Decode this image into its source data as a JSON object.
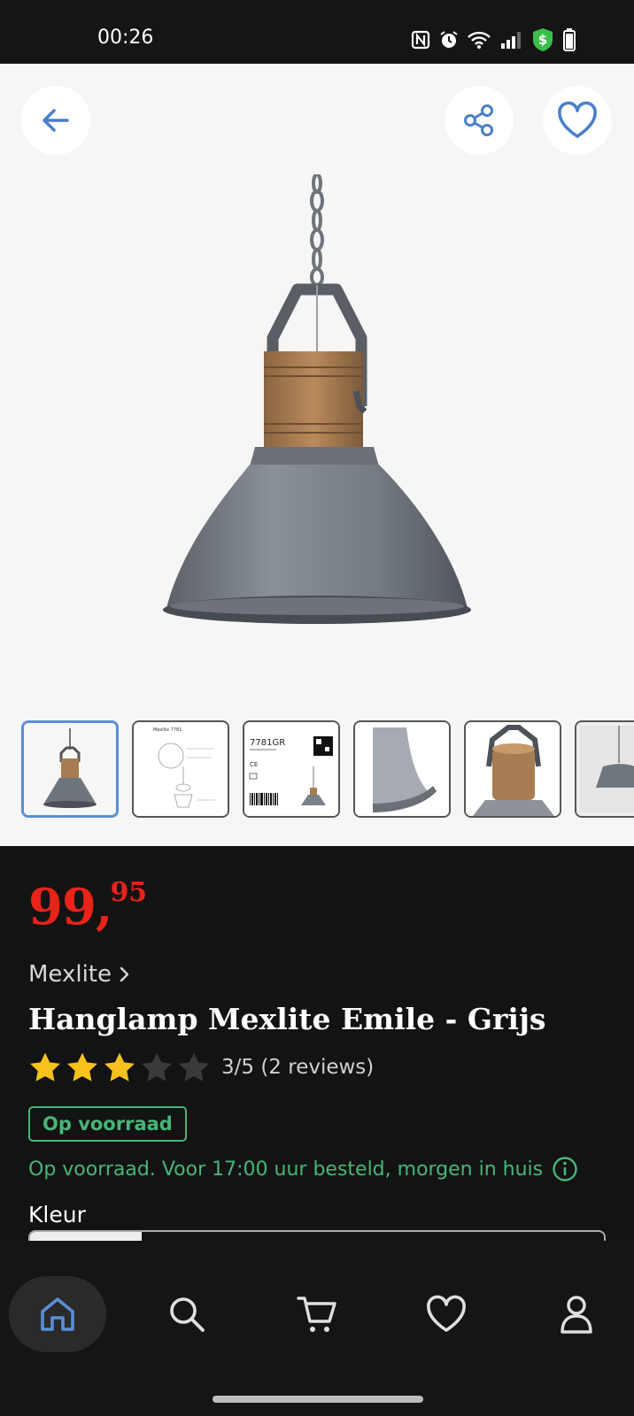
{
  "status_bar": {
    "time": "00:26",
    "icons": [
      "nfc-icon",
      "alarm-icon",
      "wifi-icon",
      "signal-icon",
      "shield-dollar-icon",
      "battery-icon"
    ]
  },
  "header": {
    "back_icon": "arrow-left-icon",
    "share_icon": "share-icon",
    "favorite_icon": "heart-icon"
  },
  "thumbnails": [
    {
      "name": "lamp-front",
      "active": true
    },
    {
      "name": "lamp-drawing",
      "active": false,
      "text": "Mexlite 7781"
    },
    {
      "name": "lamp-label",
      "active": false,
      "text": "7781GR"
    },
    {
      "name": "lamp-shade-detail",
      "active": false
    },
    {
      "name": "lamp-wood-detail",
      "active": false
    },
    {
      "name": "lamp-partial",
      "active": false
    }
  ],
  "product": {
    "price_main": "99,",
    "price_cents": "95",
    "brand": "Mexlite",
    "title": "Hanglamp Mexlite Emile - Grijs",
    "rating_value": 3,
    "rating_max": 5,
    "rating_text": "3/5 (2 reviews)",
    "stock_badge": "Op voorraad",
    "delivery_text": "Op voorraad. Voor 17:00 uur besteld, morgen in huis",
    "color_label": "Kleur"
  },
  "colors": {
    "price": "#e8231a",
    "stock": "#47b678",
    "accent": "#5b8fd6",
    "star_on": "#f7c21e",
    "star_off": "#3a3a3a"
  },
  "bottom_nav": [
    {
      "name": "home",
      "icon": "home-icon",
      "active": true
    },
    {
      "name": "search",
      "icon": "search-icon",
      "active": false
    },
    {
      "name": "cart",
      "icon": "cart-icon",
      "active": false
    },
    {
      "name": "favorites",
      "icon": "heart-icon",
      "active": false
    },
    {
      "name": "account",
      "icon": "user-icon",
      "active": false
    }
  ]
}
